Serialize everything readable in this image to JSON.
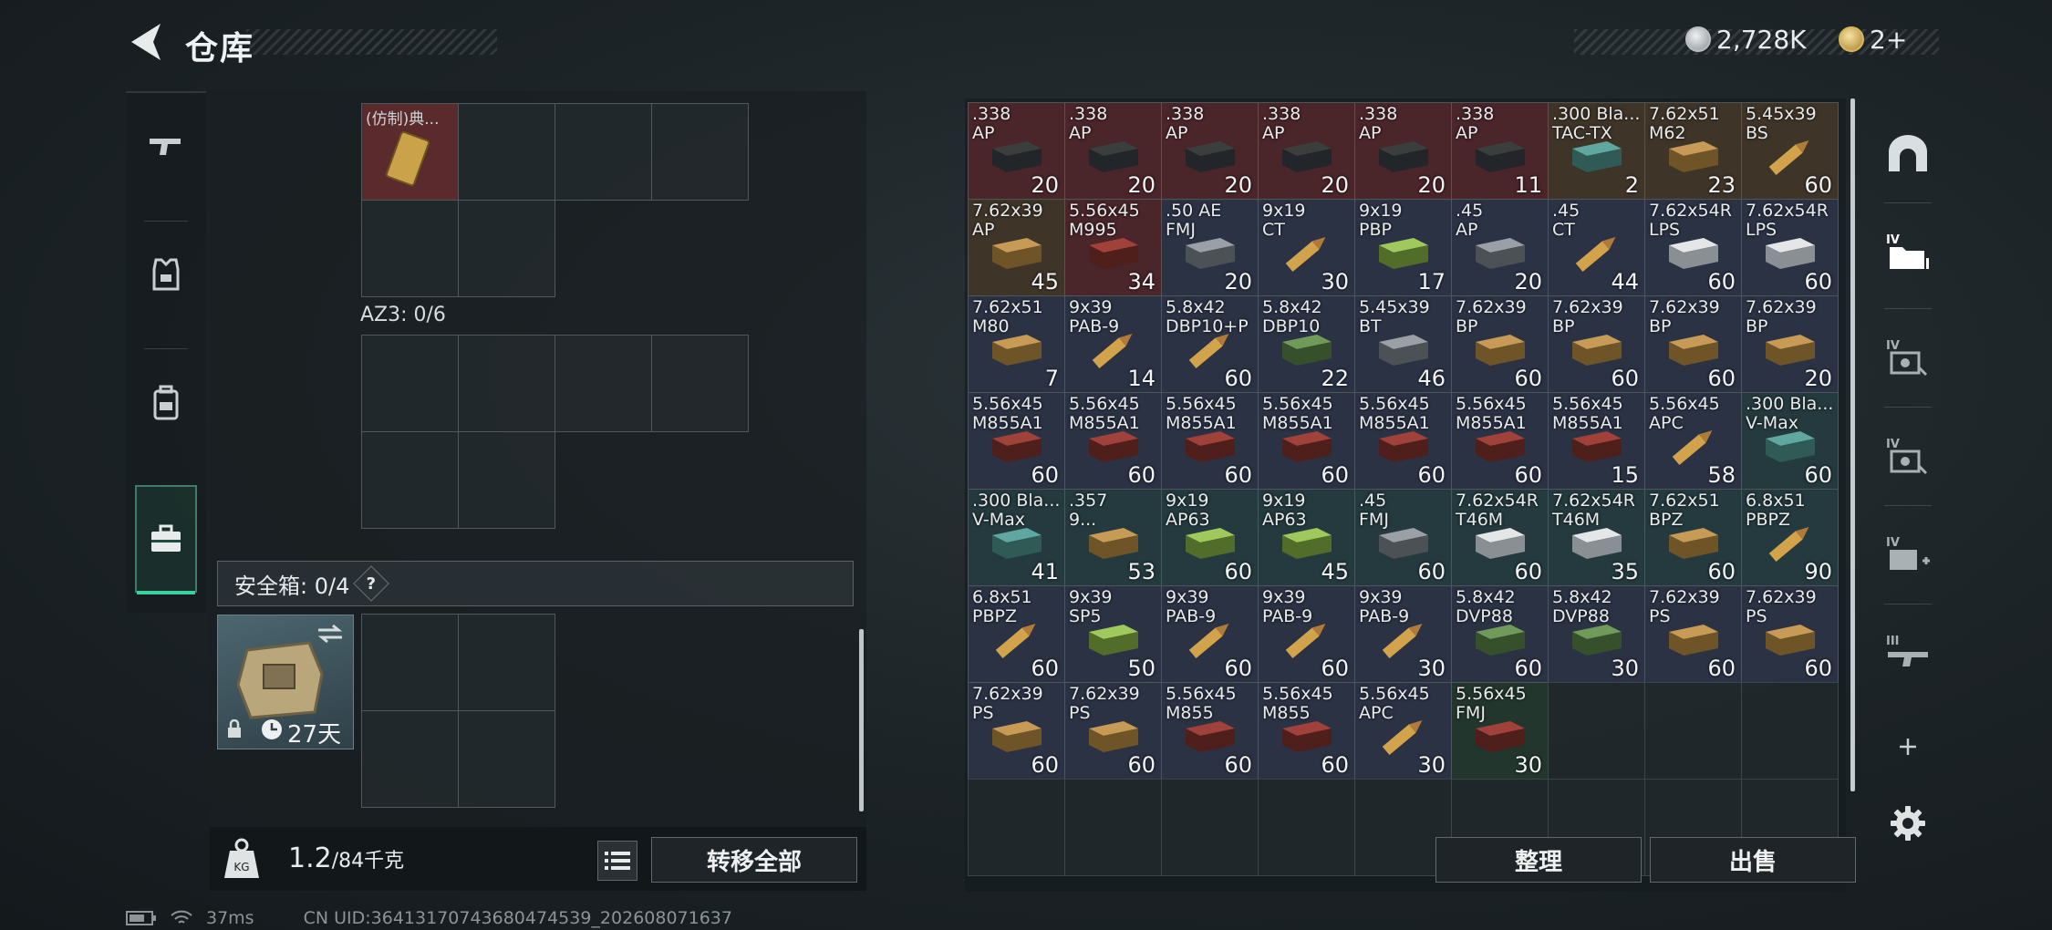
{
  "header": {
    "title": "仓库",
    "currency1_value": "2,728K",
    "currency2_value": "2+"
  },
  "left_tabs": [
    {
      "name": "weapons",
      "icon": "gun-icon"
    },
    {
      "name": "armor",
      "icon": "vest-icon"
    },
    {
      "name": "backpack",
      "icon": "backpack-icon"
    },
    {
      "name": "safebox",
      "icon": "briefcase-icon",
      "active": true
    }
  ],
  "container": {
    "top_item_label": "(仿制)典...",
    "az3_label": "AZ3: 0/6",
    "safebox_label": "安全箱: 0/4",
    "safebox_help": "?",
    "safebox_timer": "27天"
  },
  "weight": {
    "current": "1.2",
    "capacity": "/84千克"
  },
  "buttons": {
    "transfer_all": "转移全部",
    "sort": "整理",
    "sell": "出售"
  },
  "stash_items": [
    {
      "name": ".338\nAP",
      "count": "20",
      "bg": "red",
      "art": "case"
    },
    {
      "name": ".338\nAP",
      "count": "20",
      "bg": "red",
      "art": "case"
    },
    {
      "name": ".338\nAP",
      "count": "20",
      "bg": "red",
      "art": "case"
    },
    {
      "name": ".338\nAP",
      "count": "20",
      "bg": "red",
      "art": "case"
    },
    {
      "name": ".338\nAP",
      "count": "20",
      "bg": "red",
      "art": "case"
    },
    {
      "name": ".338\nAP",
      "count": "11",
      "bg": "red",
      "art": "case"
    },
    {
      "name": ".300 Bla...\nTAC-TX",
      "count": "2",
      "bg": "brown",
      "art": "teal"
    },
    {
      "name": "7.62x51\nM62",
      "count": "23",
      "bg": "brown",
      "art": "tan"
    },
    {
      "name": "5.45x39\nBS",
      "count": "60",
      "bg": "brown",
      "art": "bullet"
    },
    {
      "name": "7.62x39\nAP",
      "count": "45",
      "bg": "brown",
      "art": "tan"
    },
    {
      "name": "5.56x45\nM995",
      "count": "34",
      "bg": "red",
      "art": "red"
    },
    {
      "name": ".50 AE\nFMJ",
      "count": "20",
      "bg": "blue",
      "art": "gray"
    },
    {
      "name": "9x19\nCT",
      "count": "30",
      "bg": "blue",
      "art": "bullet"
    },
    {
      "name": "9x19\nPBP",
      "count": "17",
      "bg": "blue",
      "art": "lime"
    },
    {
      "name": ".45\nAP",
      "count": "20",
      "bg": "blue",
      "art": "gray"
    },
    {
      "name": ".45\nCT",
      "count": "44",
      "bg": "blue",
      "art": "bullet"
    },
    {
      "name": "7.62x54R\nLPS",
      "count": "60",
      "bg": "blue",
      "art": "white"
    },
    {
      "name": "7.62x54R\nLPS",
      "count": "60",
      "bg": "blue",
      "art": "white"
    },
    {
      "name": "7.62x51\nM80",
      "count": "7",
      "bg": "blue",
      "art": "tan"
    },
    {
      "name": "9x39\nPAB-9",
      "count": "14",
      "bg": "blue",
      "art": "bullet"
    },
    {
      "name": "5.8x42\nDBP10+P",
      "count": "60",
      "bg": "blue",
      "art": "bullet"
    },
    {
      "name": "5.8x42\nDBP10",
      "count": "22",
      "bg": "blue",
      "art": "green"
    },
    {
      "name": "5.45x39\nBT",
      "count": "46",
      "bg": "blue",
      "art": "gray"
    },
    {
      "name": "7.62x39\nBP",
      "count": "60",
      "bg": "blue",
      "art": "tan"
    },
    {
      "name": "7.62x39\nBP",
      "count": "60",
      "bg": "blue",
      "art": "tan"
    },
    {
      "name": "7.62x39\nBP",
      "count": "60",
      "bg": "blue",
      "art": "tan"
    },
    {
      "name": "7.62x39\nBP",
      "count": "20",
      "bg": "blue",
      "art": "tan"
    },
    {
      "name": "5.56x45\nM855A1",
      "count": "60",
      "bg": "blue",
      "art": "red"
    },
    {
      "name": "5.56x45\nM855A1",
      "count": "60",
      "bg": "blue",
      "art": "red"
    },
    {
      "name": "5.56x45\nM855A1",
      "count": "60",
      "bg": "blue",
      "art": "red"
    },
    {
      "name": "5.56x45\nM855A1",
      "count": "60",
      "bg": "blue",
      "art": "red"
    },
    {
      "name": "5.56x45\nM855A1",
      "count": "60",
      "bg": "blue",
      "art": "red"
    },
    {
      "name": "5.56x45\nM855A1",
      "count": "60",
      "bg": "blue",
      "art": "red"
    },
    {
      "name": "5.56x45\nM855A1",
      "count": "15",
      "bg": "blue",
      "art": "red"
    },
    {
      "name": "5.56x45\nAPC",
      "count": "58",
      "bg": "blue",
      "art": "bullet"
    },
    {
      "name": ".300 Bla...\nV-Max",
      "count": "60",
      "bg": "teal",
      "art": "teal"
    },
    {
      "name": ".300 Bla...\nV-Max",
      "count": "41",
      "bg": "teal",
      "art": "teal"
    },
    {
      "name": ".357\n9...",
      "count": "53",
      "bg": "teal",
      "art": "tan"
    },
    {
      "name": "9x19\nAP63",
      "count": "60",
      "bg": "teal",
      "art": "lime"
    },
    {
      "name": "9x19\nAP63",
      "count": "45",
      "bg": "teal",
      "art": "lime"
    },
    {
      "name": ".45\nFMJ",
      "count": "60",
      "bg": "teal",
      "art": "gray"
    },
    {
      "name": "7.62x54R\nT46M",
      "count": "60",
      "bg": "teal",
      "art": "white"
    },
    {
      "name": "7.62x54R\nT46M",
      "count": "35",
      "bg": "teal",
      "art": "white"
    },
    {
      "name": "7.62x51\nBPZ",
      "count": "60",
      "bg": "teal",
      "art": "tan"
    },
    {
      "name": "6.8x51\nPBPZ",
      "count": "90",
      "bg": "teal",
      "art": "bullet"
    },
    {
      "name": "6.8x51\nPBPZ",
      "count": "60",
      "bg": "blue",
      "art": "bullet"
    },
    {
      "name": "9x39\nSP5",
      "count": "50",
      "bg": "blue",
      "art": "lime"
    },
    {
      "name": "9x39\nPAB-9",
      "count": "60",
      "bg": "blue",
      "art": "bullet"
    },
    {
      "name": "9x39\nPAB-9",
      "count": "60",
      "bg": "blue",
      "art": "bullet"
    },
    {
      "name": "9x39\nPAB-9",
      "count": "30",
      "bg": "blue",
      "art": "bullet"
    },
    {
      "name": "5.8x42\nDVP88",
      "count": "60",
      "bg": "blue",
      "art": "green"
    },
    {
      "name": "5.8x42\nDVP88",
      "count": "30",
      "bg": "blue",
      "art": "green"
    },
    {
      "name": "7.62x39\nPS",
      "count": "60",
      "bg": "blue",
      "art": "tan"
    },
    {
      "name": "7.62x39\nPS",
      "count": "60",
      "bg": "blue",
      "art": "tan"
    },
    {
      "name": "7.62x39\nPS",
      "count": "60",
      "bg": "blue",
      "art": "tan"
    },
    {
      "name": "7.62x39\nPS",
      "count": "60",
      "bg": "blue",
      "art": "tan"
    },
    {
      "name": "5.56x45\nM855",
      "count": "60",
      "bg": "blue",
      "art": "red"
    },
    {
      "name": "5.56x45\nM855",
      "count": "60",
      "bg": "blue",
      "art": "red"
    },
    {
      "name": "5.56x45\nAPC",
      "count": "30",
      "bg": "blue",
      "art": "bullet"
    },
    {
      "name": "5.56x45\nFMJ",
      "count": "30",
      "bg": "green",
      "art": "red"
    }
  ],
  "right_tabs": [
    {
      "name": "ammo",
      "icon": "shield-arch-icon"
    },
    {
      "name": "tier4-folder",
      "icon": "tier-folder-icon",
      "active": true
    },
    {
      "name": "tier4-a",
      "icon": "tier-key-icon"
    },
    {
      "name": "tier4-b",
      "icon": "tier-key-icon"
    },
    {
      "name": "tier4-med",
      "icon": "tier-med-icon"
    },
    {
      "name": "tier3-gun",
      "icon": "tier-gun-icon"
    }
  ],
  "footer": {
    "ping": "37ms",
    "uid": "CN UID:36413170743680474539_202608071637"
  },
  "colors": {
    "accent_green": "#38d39a",
    "bg_red": "#4a2529",
    "bg_blue": "#2b3244",
    "bg_teal": "#243a3e",
    "bg_brown": "#3f3428"
  }
}
